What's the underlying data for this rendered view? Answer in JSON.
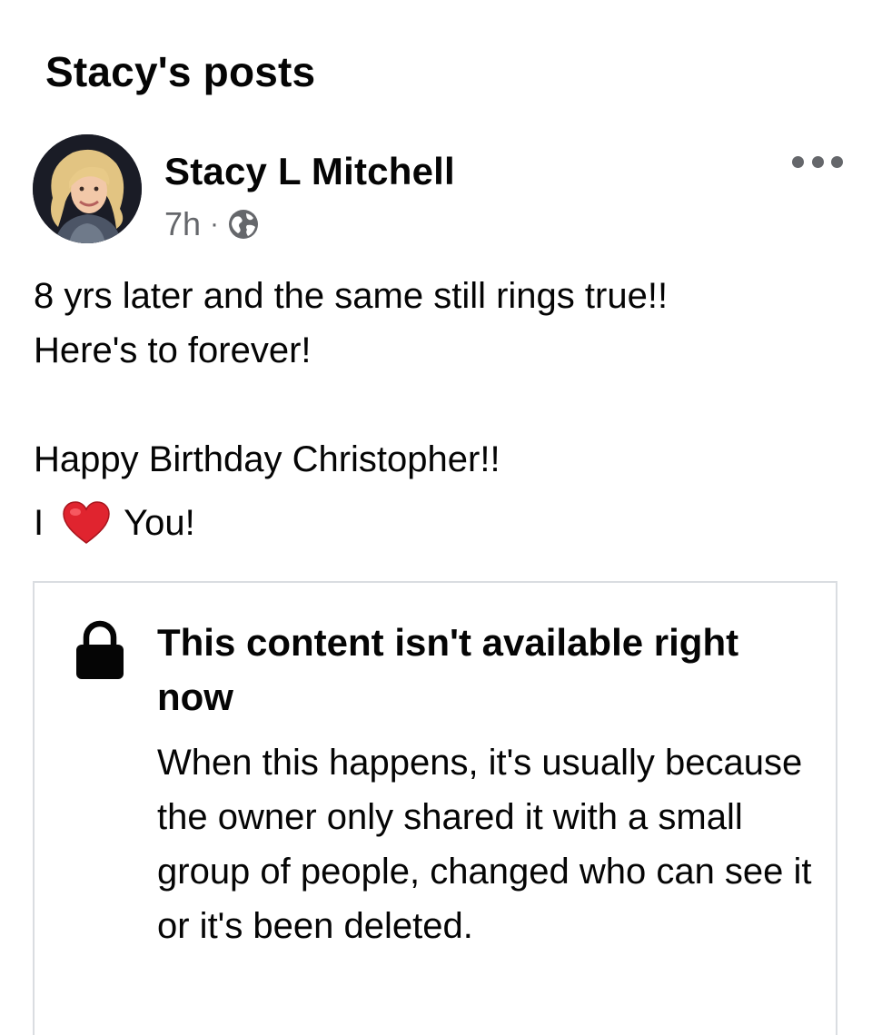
{
  "page": {
    "title": "Stacy's posts"
  },
  "post": {
    "author": "Stacy L Mitchell",
    "time": "7h",
    "separator": "·",
    "audience_icon": "globe-icon",
    "menu_icon": "more-horizontal-icon",
    "text_lines": [
      "8 yrs later and the same still rings true!!",
      "Here's to forever!",
      "Happy Birthday Christopher!!"
    ],
    "heart_line": {
      "before": "I",
      "emoji": "❤️",
      "after": "You!"
    }
  },
  "shared_content": {
    "icon": "lock-icon",
    "title": "This content isn't available right now",
    "body": "When this happens, it's usually because the owner only shared it with a small group of people, changed who can see it or it's been deleted."
  },
  "colors": {
    "text_primary": "#050505",
    "text_secondary": "#65676b",
    "border": "#dadde1",
    "heart": "#e0242f"
  }
}
